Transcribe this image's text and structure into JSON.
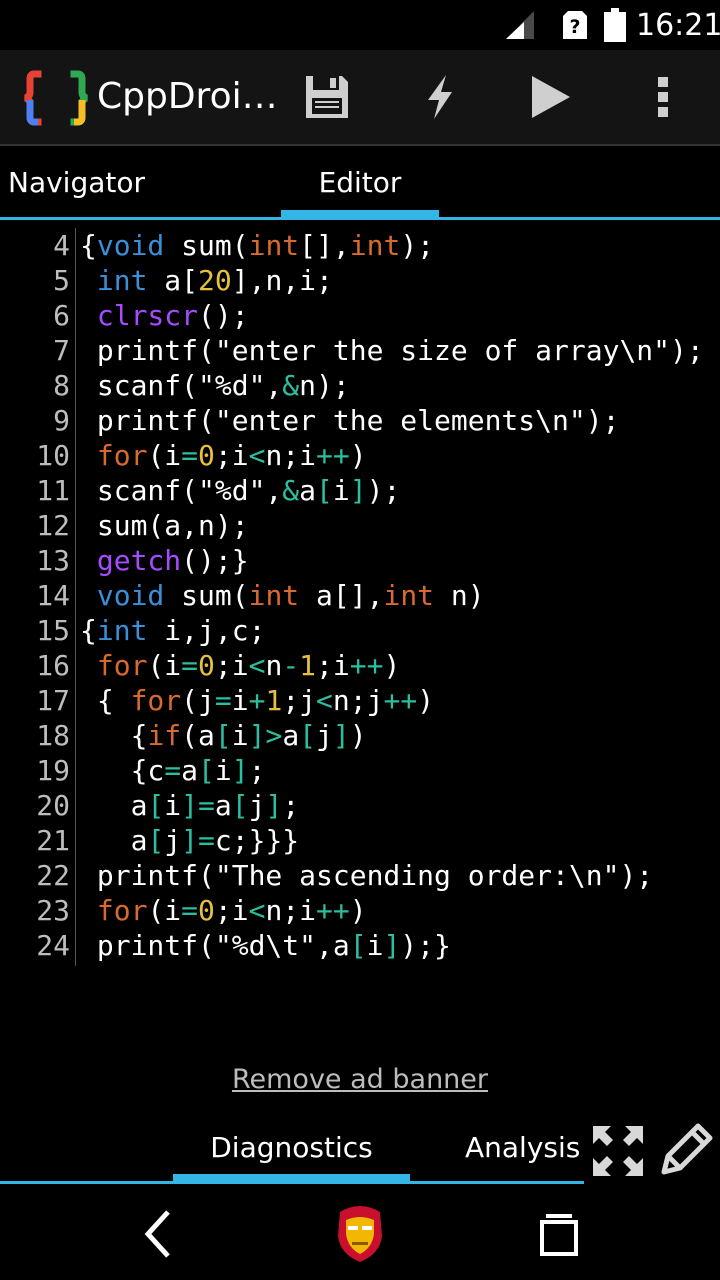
{
  "status_bar": {
    "time": "16:21",
    "icons": [
      "signal-icon",
      "sim-unknown-icon",
      "battery-icon"
    ]
  },
  "action_bar": {
    "title": "CppDroi…",
    "logo": "cppdroid-logo",
    "actions": [
      "save-icon",
      "build-icon",
      "run-icon",
      "overflow-menu-icon"
    ]
  },
  "tabs": {
    "navigator": "Navigator",
    "editor": "Editor",
    "active": "Editor"
  },
  "code_lines": [
    {
      "n": "4",
      "tokens": [
        [
          "p",
          "{"
        ],
        [
          "k",
          "void"
        ],
        [
          "p",
          " sum("
        ],
        [
          "t",
          "int"
        ],
        [
          "p",
          "[],"
        ],
        [
          "t",
          "int"
        ],
        [
          "p",
          ");"
        ]
      ]
    },
    {
      "n": "5",
      "tokens": [
        [
          "p",
          " "
        ],
        [
          "k",
          "int"
        ],
        [
          "p",
          " a["
        ],
        [
          "d",
          "20"
        ],
        [
          "p",
          "],n,i;"
        ]
      ]
    },
    {
      "n": "6",
      "tokens": [
        [
          "p",
          " "
        ],
        [
          "f",
          "clrscr"
        ],
        [
          "p",
          "();"
        ]
      ]
    },
    {
      "n": "7",
      "tokens": [
        [
          "p",
          " printf(\"enter the size of array\\n\");"
        ]
      ]
    },
    {
      "n": "8",
      "tokens": [
        [
          "p",
          " scanf(\"%d\","
        ],
        [
          "o",
          "&"
        ],
        [
          "p",
          "n);"
        ]
      ]
    },
    {
      "n": "9",
      "tokens": [
        [
          "p",
          " printf(\"enter the elements\\n\");"
        ]
      ]
    },
    {
      "n": "10",
      "tokens": [
        [
          "p",
          " "
        ],
        [
          "t",
          "for"
        ],
        [
          "p",
          "(i"
        ],
        [
          "o",
          "="
        ],
        [
          "d",
          "0"
        ],
        [
          "p",
          ";i"
        ],
        [
          "o",
          "<"
        ],
        [
          "p",
          "n;i"
        ],
        [
          "o",
          "++"
        ],
        [
          "p",
          ")"
        ]
      ]
    },
    {
      "n": "11",
      "tokens": [
        [
          "p",
          " scanf(\"%d\","
        ],
        [
          "o",
          "&"
        ],
        [
          "p",
          "a"
        ],
        [
          "o",
          "["
        ],
        [
          "p",
          "i"
        ],
        [
          "o",
          "]"
        ],
        [
          "p",
          ");"
        ]
      ]
    },
    {
      "n": "12",
      "tokens": [
        [
          "p",
          " sum(a,n);"
        ]
      ]
    },
    {
      "n": "13",
      "tokens": [
        [
          "p",
          " "
        ],
        [
          "f",
          "getch"
        ],
        [
          "p",
          "();}"
        ]
      ]
    },
    {
      "n": "14",
      "tokens": [
        [
          "p",
          " "
        ],
        [
          "k",
          "void"
        ],
        [
          "p",
          " sum("
        ],
        [
          "t",
          "int"
        ],
        [
          "p",
          " a[],"
        ],
        [
          "t",
          "int"
        ],
        [
          "p",
          " n)"
        ]
      ]
    },
    {
      "n": "15",
      "tokens": [
        [
          "p",
          "{"
        ],
        [
          "k",
          "int"
        ],
        [
          "p",
          " i,j,c;"
        ]
      ]
    },
    {
      "n": "16",
      "tokens": [
        [
          "p",
          " "
        ],
        [
          "t",
          "for"
        ],
        [
          "p",
          "(i"
        ],
        [
          "o",
          "="
        ],
        [
          "d",
          "0"
        ],
        [
          "p",
          ";i"
        ],
        [
          "o",
          "<"
        ],
        [
          "p",
          "n"
        ],
        [
          "o",
          "-"
        ],
        [
          "d",
          "1"
        ],
        [
          "p",
          ";i"
        ],
        [
          "o",
          "++"
        ],
        [
          "p",
          ")"
        ]
      ]
    },
    {
      "n": "17",
      "tokens": [
        [
          "p",
          " { "
        ],
        [
          "t",
          "for"
        ],
        [
          "p",
          "(j"
        ],
        [
          "o",
          "="
        ],
        [
          "p",
          "i"
        ],
        [
          "o",
          "+"
        ],
        [
          "d",
          "1"
        ],
        [
          "p",
          ";j"
        ],
        [
          "o",
          "<"
        ],
        [
          "p",
          "n;j"
        ],
        [
          "o",
          "++"
        ],
        [
          "p",
          ")"
        ]
      ]
    },
    {
      "n": "18",
      "tokens": [
        [
          "p",
          "   {"
        ],
        [
          "t",
          "if"
        ],
        [
          "p",
          "(a"
        ],
        [
          "o",
          "["
        ],
        [
          "p",
          "i"
        ],
        [
          "o",
          "]>"
        ],
        [
          "p",
          "a"
        ],
        [
          "o",
          "["
        ],
        [
          "p",
          "j"
        ],
        [
          "o",
          "]"
        ],
        [
          "p",
          ")"
        ]
      ]
    },
    {
      "n": "19",
      "tokens": [
        [
          "p",
          "   {c"
        ],
        [
          "o",
          "="
        ],
        [
          "p",
          "a"
        ],
        [
          "o",
          "["
        ],
        [
          "p",
          "i"
        ],
        [
          "o",
          "]"
        ],
        [
          "p",
          ";"
        ]
      ]
    },
    {
      "n": "20",
      "tokens": [
        [
          "p",
          "   a"
        ],
        [
          "o",
          "["
        ],
        [
          "p",
          "i"
        ],
        [
          "o",
          "]="
        ],
        [
          "p",
          "a"
        ],
        [
          "o",
          "["
        ],
        [
          "p",
          "j"
        ],
        [
          "o",
          "]"
        ],
        [
          "p",
          ";"
        ]
      ]
    },
    {
      "n": "21",
      "tokens": [
        [
          "p",
          "   a"
        ],
        [
          "o",
          "["
        ],
        [
          "p",
          "j"
        ],
        [
          "o",
          "]="
        ],
        [
          "p",
          "c;}}}"
        ]
      ]
    },
    {
      "n": "22",
      "tokens": [
        [
          "p",
          " printf(\"The ascending order:\\n\");"
        ]
      ]
    },
    {
      "n": "23",
      "tokens": [
        [
          "p",
          " "
        ],
        [
          "t",
          "for"
        ],
        [
          "p",
          "(i"
        ],
        [
          "o",
          "="
        ],
        [
          "d",
          "0"
        ],
        [
          "p",
          ";i"
        ],
        [
          "o",
          "<"
        ],
        [
          "p",
          "n;i"
        ],
        [
          "o",
          "++"
        ],
        [
          "p",
          ")"
        ]
      ]
    },
    {
      "n": "24",
      "tokens": [
        [
          "p",
          " printf(\"%d\\t\",a"
        ],
        [
          "o",
          "["
        ],
        [
          "p",
          "i"
        ],
        [
          "o",
          "]"
        ],
        [
          "p",
          ");}"
        ]
      ]
    }
  ],
  "ad": {
    "remove_label": "Remove ad banner"
  },
  "bottom_tabs": {
    "diagnostics": "Diagnostics",
    "analysis": "Analysis",
    "active": "Diagnostics",
    "icons": [
      "expand-icon",
      "edit-icon"
    ]
  },
  "nav_bar": {
    "icons": [
      "back-icon",
      "home-icon",
      "recents-icon"
    ]
  },
  "colors": {
    "accent": "#33b5e5",
    "keyword": "#3a8fdb",
    "type": "#d86a2e",
    "number": "#e6c23b",
    "operator": "#2bbfa0",
    "function": "#a64bff"
  }
}
